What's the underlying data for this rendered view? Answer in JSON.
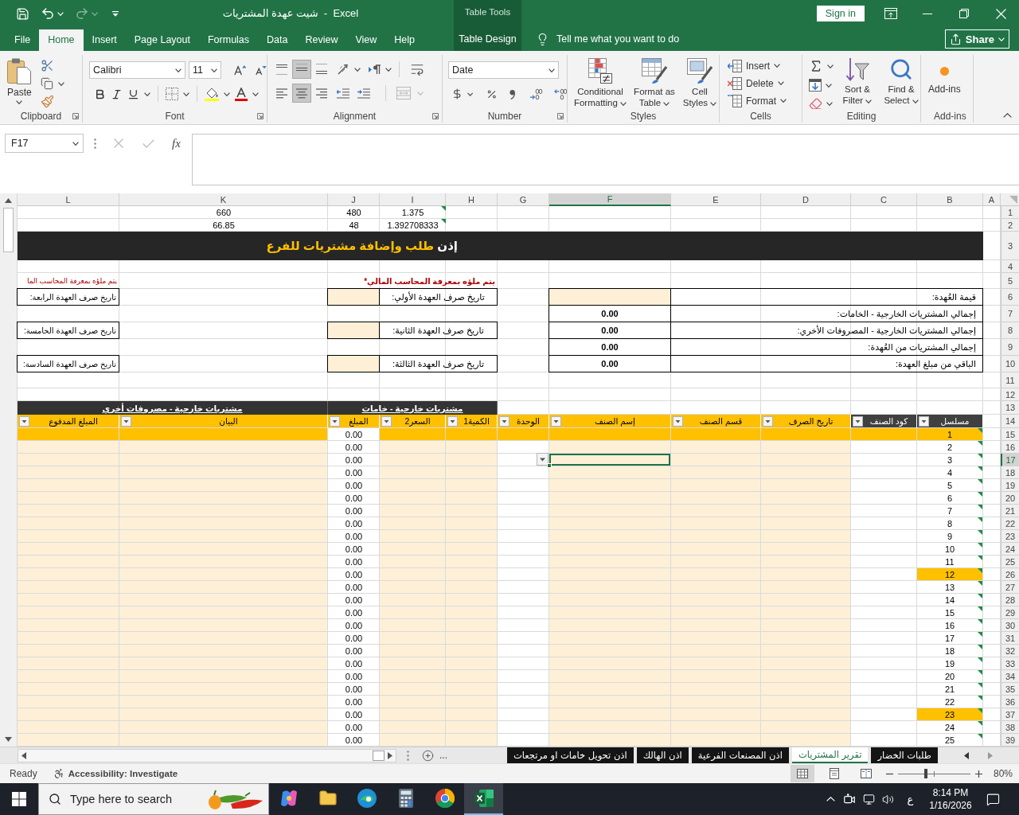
{
  "window": {
    "title": "شيت عهدة المشتريات  -  Excel",
    "context_label": "Table Tools",
    "sign_in": "Sign in"
  },
  "quick_access": {
    "undo": {
      "disabled": false
    },
    "redo": {
      "disabled": true
    }
  },
  "ribbon_tabs": [
    {
      "label": "File",
      "selected": false,
      "kind": "standard"
    },
    {
      "label": "Home",
      "selected": true,
      "kind": "standard"
    },
    {
      "label": "Insert",
      "selected": false,
      "kind": "standard"
    },
    {
      "label": "Page Layout",
      "selected": false,
      "kind": "standard"
    },
    {
      "label": "Formulas",
      "selected": false,
      "kind": "standard"
    },
    {
      "label": "Data",
      "selected": false,
      "kind": "standard"
    },
    {
      "label": "Review",
      "selected": false,
      "kind": "standard"
    },
    {
      "label": "View",
      "selected": false,
      "kind": "standard"
    },
    {
      "label": "Help",
      "selected": false,
      "kind": "standard"
    },
    {
      "label": "Table Design",
      "selected": false,
      "kind": "contextual"
    }
  ],
  "tell_me": {
    "placeholder": "Tell me what you want to do"
  },
  "share": "Share",
  "ribbon": {
    "clipboard": {
      "label": "Clipboard",
      "paste": "Paste"
    },
    "font": {
      "label": "Font",
      "font_name": "Calibri",
      "font_size": "11"
    },
    "alignment": {
      "label": "Alignment",
      "vertical": [
        {
          "selected": false
        },
        {
          "selected": true
        },
        {
          "selected": false
        }
      ],
      "horizontal": [
        {
          "selected": false
        },
        {
          "selected": true
        },
        {
          "selected": false
        }
      ],
      "merge_disabled": true
    },
    "number": {
      "label": "Number",
      "format": "Date"
    },
    "styles": {
      "label": "Styles",
      "buttons": [
        {
          "label": "Conditional Formatting",
          "kind": "conditional"
        },
        {
          "label": "Format as Table",
          "kind": "table"
        },
        {
          "label": "Cell Styles",
          "kind": "cell"
        }
      ]
    },
    "cells": {
      "label": "Cells",
      "buttons": [
        {
          "label": "Insert",
          "kind": "insert"
        },
        {
          "label": "Delete",
          "kind": "delete"
        },
        {
          "label": "Format",
          "kind": "format"
        }
      ]
    },
    "editing": {
      "label": "Editing",
      "buttons": [
        {
          "label": "Sort & Filter",
          "kind": "sort"
        },
        {
          "label": "Find & Select",
          "kind": "find"
        }
      ]
    },
    "addins": {
      "label": "Add-ins",
      "button": "Add-ins"
    }
  },
  "formula_bar": {
    "name_box": "F17",
    "confirm_disabled": true,
    "function_button": "fx"
  },
  "sheet": {
    "columns": [
      {
        "label": "L",
        "selected": false
      },
      {
        "label": "K",
        "selected": false
      },
      {
        "label": "J",
        "selected": false
      },
      {
        "label": "I",
        "selected": false
      },
      {
        "label": "H",
        "selected": false
      },
      {
        "label": "G",
        "selected": false
      },
      {
        "label": "F",
        "selected": true
      },
      {
        "label": "E",
        "selected": false
      },
      {
        "label": "D",
        "selected": false
      },
      {
        "label": "C",
        "selected": false
      },
      {
        "label": "B",
        "selected": false
      },
      {
        "label": "A",
        "selected": false
      }
    ],
    "row_numbers": [
      {
        "label": "1",
        "selected": false
      },
      {
        "label": "2",
        "selected": false
      },
      {
        "label": "3",
        "selected": false
      },
      {
        "label": "4",
        "selected": false
      },
      {
        "label": "5",
        "selected": false
      },
      {
        "label": "6",
        "selected": false
      },
      {
        "label": "7",
        "selected": false
      },
      {
        "label": "8",
        "selected": false
      },
      {
        "label": "9",
        "selected": false
      },
      {
        "label": "10",
        "selected": false
      },
      {
        "label": "11",
        "selected": false
      },
      {
        "label": "12",
        "selected": false
      },
      {
        "label": "13",
        "selected": false
      },
      {
        "label": "14",
        "selected": false
      },
      {
        "label": "15",
        "selected": false
      },
      {
        "label": "16",
        "selected": false
      },
      {
        "label": "17",
        "selected": true
      },
      {
        "label": "18",
        "selected": false
      },
      {
        "label": "19",
        "selected": false
      },
      {
        "label": "20",
        "selected": false
      },
      {
        "label": "21",
        "selected": false
      },
      {
        "label": "22",
        "selected": false
      },
      {
        "label": "23",
        "selected": false
      },
      {
        "label": "24",
        "selected": false
      },
      {
        "label": "25",
        "selected": false
      },
      {
        "label": "26",
        "selected": false
      },
      {
        "label": "27",
        "selected": false
      },
      {
        "label": "28",
        "selected": false
      },
      {
        "label": "29",
        "selected": false
      },
      {
        "label": "30",
        "selected": false
      },
      {
        "label": "31",
        "selected": false
      },
      {
        "label": "32",
        "selected": false
      },
      {
        "label": "33",
        "selected": false
      },
      {
        "label": "34",
        "selected": false
      },
      {
        "label": "35",
        "selected": false
      },
      {
        "label": "36",
        "selected": false
      },
      {
        "label": "37",
        "selected": false
      },
      {
        "label": "38",
        "selected": false
      },
      {
        "label": "39",
        "selected": false
      }
    ],
    "top_rows": [
      {
        "values": [
          "660",
          "480",
          "1.375"
        ],
        "flagged": true
      },
      {
        "values": [
          "66.85",
          "48",
          "1.392708333"
        ],
        "flagged": true
      }
    ],
    "banner": {
      "lead": "إذن",
      "text": "طلب وإضافة مشتريات للفرع"
    },
    "notes": [
      "يتم ملؤه بمعرفة المحاسب المالي*",
      "يتم ملؤه بمعرفة المحاسب الما"
    ],
    "custody_dates": {
      "middle": [
        "تاريخ صرف العهدة الأولي:",
        "تاريخ صرف العهدة الثانية:",
        "تاريخ صرف العهدة الثالثة:"
      ],
      "left": [
        "تاريخ صرف العهدة الرابعة:",
        "تاريخ صرف العهدة الخامسة:",
        "تاريخ صرف العهدة السادسة:"
      ]
    },
    "summary": [
      {
        "label": "قيمة العُهدة:",
        "kind": "input"
      },
      {
        "label": "إجمالي المشتريات الخارجية - الخامات:",
        "kind": "total",
        "value": "0.00"
      },
      {
        "label": "إجمالي المشتريات الخارجية - المصروفات الأخري:",
        "kind": "total",
        "value": "0.00"
      },
      {
        "label": "إجمالي المشتريات من العُهدة:",
        "kind": "total",
        "value": "0.00"
      },
      {
        "label": "الباقي من مبلغ العهدة:",
        "kind": "total",
        "value": "0.00"
      }
    ],
    "group_headers": [
      "مشتريات خارجية - خامات",
      "مشتريات خارجية - مصروفات أخري"
    ],
    "table": {
      "columns": [
        {
          "label": "مسلسل",
          "kind": "dark"
        },
        {
          "label": "كود الصنف",
          "kind": "dark"
        },
        {
          "label": "تاريخ الصرف",
          "kind": "accent"
        },
        {
          "label": "قسم الصنف",
          "kind": "accent"
        },
        {
          "label": "إسم الصنف",
          "kind": "accent"
        },
        {
          "label": "الوحدة",
          "kind": "accent"
        },
        {
          "label": "الكمية1",
          "kind": "accent"
        },
        {
          "label": "السعر2",
          "kind": "accent"
        },
        {
          "label": "المبلغ",
          "kind": "accent"
        },
        {
          "label": "البيان",
          "kind": "accent"
        },
        {
          "label": "المبلغ المدفوع",
          "kind": "accent"
        }
      ],
      "rows": [
        {
          "serial": "1",
          "amount": "0.00",
          "highlighted": true,
          "row_highlighted": true,
          "flagged": true
        },
        {
          "serial": "2",
          "amount": "0.00",
          "highlighted": false,
          "row_highlighted": false,
          "flagged": true
        },
        {
          "serial": "3",
          "amount": "0.00",
          "highlighted": false,
          "row_highlighted": false,
          "flagged": true
        },
        {
          "serial": "4",
          "amount": "0.00",
          "highlighted": false,
          "row_highlighted": false,
          "flagged": true
        },
        {
          "serial": "5",
          "amount": "0.00",
          "highlighted": false,
          "row_highlighted": false,
          "flagged": true
        },
        {
          "serial": "6",
          "amount": "0.00",
          "highlighted": false,
          "row_highlighted": false,
          "flagged": true
        },
        {
          "serial": "7",
          "amount": "0.00",
          "highlighted": false,
          "row_highlighted": false,
          "flagged": true
        },
        {
          "serial": "8",
          "amount": "0.00",
          "highlighted": false,
          "row_highlighted": false,
          "flagged": true
        },
        {
          "serial": "9",
          "amount": "0.00",
          "highlighted": false,
          "row_highlighted": false,
          "flagged": true
        },
        {
          "serial": "10",
          "amount": "0.00",
          "highlighted": false,
          "row_highlighted": false,
          "flagged": true
        },
        {
          "serial": "11",
          "amount": "0.00",
          "highlighted": false,
          "row_highlighted": false,
          "flagged": true
        },
        {
          "serial": "12",
          "amount": "0.00",
          "highlighted": true,
          "row_highlighted": false,
          "flagged": true
        },
        {
          "serial": "13",
          "amount": "0.00",
          "highlighted": false,
          "row_highlighted": false,
          "flagged": true
        },
        {
          "serial": "14",
          "amount": "0.00",
          "highlighted": false,
          "row_highlighted": false,
          "flagged": true
        },
        {
          "serial": "15",
          "amount": "0.00",
          "highlighted": false,
          "row_highlighted": false,
          "flagged": true
        },
        {
          "serial": "16",
          "amount": "0.00",
          "highlighted": false,
          "row_highlighted": false,
          "flagged": true
        },
        {
          "serial": "17",
          "amount": "0.00",
          "highlighted": false,
          "row_highlighted": false,
          "flagged": true
        },
        {
          "serial": "18",
          "amount": "0.00",
          "highlighted": false,
          "row_highlighted": false,
          "flagged": true
        },
        {
          "serial": "19",
          "amount": "0.00",
          "highlighted": false,
          "row_highlighted": false,
          "flagged": true
        },
        {
          "serial": "20",
          "amount": "0.00",
          "highlighted": false,
          "row_highlighted": false,
          "flagged": true
        },
        {
          "serial": "21",
          "amount": "0.00",
          "highlighted": false,
          "row_highlighted": false,
          "flagged": true
        },
        {
          "serial": "22",
          "amount": "0.00",
          "highlighted": false,
          "row_highlighted": false,
          "flagged": true
        },
        {
          "serial": "23",
          "amount": "0.00",
          "highlighted": true,
          "row_highlighted": false,
          "flagged": true
        },
        {
          "serial": "24",
          "amount": "0.00",
          "highlighted": false,
          "row_highlighted": false,
          "flagged": true
        },
        {
          "serial": "25",
          "amount": "0.00",
          "highlighted": false,
          "row_highlighted": false,
          "flagged": true
        }
      ]
    },
    "cell_dropdown": true
  },
  "sheet_tabs": {
    "more": "...",
    "tabs": [
      {
        "label": "طلبات الخضار",
        "selected": false
      },
      {
        "label": "تقرير المشتريات",
        "selected": true
      },
      {
        "label": "اذن المصنعات الفرعية",
        "selected": false
      },
      {
        "label": "اذن الهالك",
        "selected": false
      },
      {
        "label": "اذن تحويل خامات او مرتجعات",
        "selected": false
      }
    ]
  },
  "status_bar": {
    "status": "Ready",
    "accessibility": "Accessibility: Investigate",
    "views": [
      {
        "kind": "normal",
        "selected": true
      },
      {
        "kind": "page_layout",
        "selected": false
      },
      {
        "kind": "page_break",
        "selected": false
      }
    ],
    "zoom": {
      "level": 0.39,
      "reading": "80%"
    }
  },
  "taskbar": {
    "search": {
      "placeholder": "Type here to search"
    },
    "apps": [
      {
        "kind": "assistant",
        "active": false
      },
      {
        "kind": "folder",
        "active": false
      },
      {
        "kind": "browser",
        "active": false
      },
      {
        "kind": "calculator",
        "active": false
      },
      {
        "kind": "globe",
        "active": false
      },
      {
        "kind": "spreadsheet",
        "active": true
      }
    ],
    "tray": {
      "language": "ع",
      "time": "8:14 PM",
      "date": "1/16/2026"
    }
  }
}
